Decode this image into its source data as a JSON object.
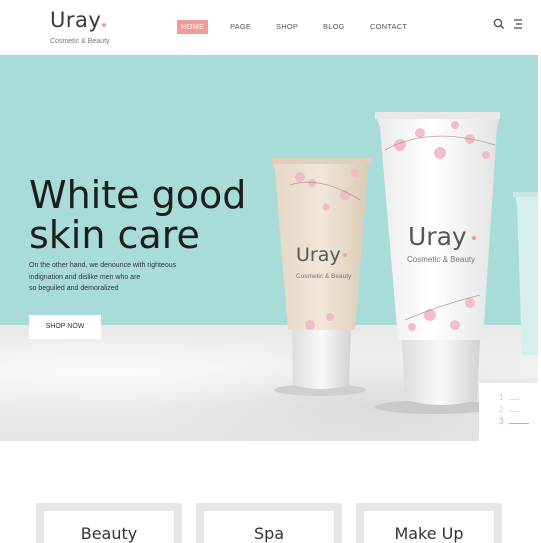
{
  "brand": {
    "name": "Uray",
    "tagline": "Cosmetic & Beauty",
    "accent_color": "#f29a9a"
  },
  "nav": {
    "items": [
      {
        "label": "HOME",
        "active": true
      },
      {
        "label": "PAGE",
        "active": false
      },
      {
        "label": "SHOP",
        "active": false
      },
      {
        "label": "BLOG",
        "active": false
      },
      {
        "label": "CONTACT",
        "active": false
      }
    ],
    "icons": [
      "search-icon",
      "menu-icon"
    ]
  },
  "hero": {
    "title_line1": "White good",
    "title_line2": "skin care",
    "description_line1": "On the other hand, we denounce with righteous",
    "description_line2": "indignation and dislike men who are",
    "description_line3": "so beguiled and demoralized",
    "button_label": "SHOP NOW",
    "background_color": "#a8dcd9",
    "product_left_brand": "Uray",
    "product_left_tagline": "Cosmetic & Beauty",
    "product_right_brand": "Uray",
    "product_right_tagline": "Cosmetic & Beauty",
    "slides": [
      "1",
      "2",
      "3"
    ],
    "active_slide": "3"
  },
  "categories": [
    {
      "label": "Beauty"
    },
    {
      "label": "Spa"
    },
    {
      "label": "Make Up"
    }
  ]
}
